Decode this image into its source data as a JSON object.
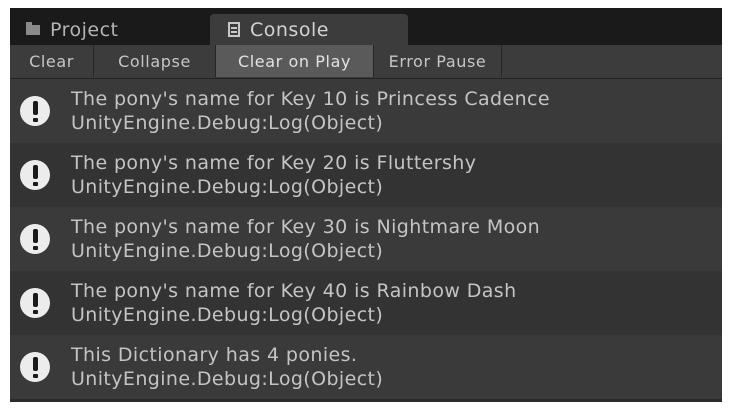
{
  "tabs": [
    {
      "label": "Project",
      "icon": "folder-icon",
      "active": false
    },
    {
      "label": "Console",
      "icon": "console-icon",
      "active": true
    }
  ],
  "toolbar": {
    "clear": "Clear",
    "collapse": "Collapse",
    "clear_on_play": "Clear on Play",
    "error_pause": "Error Pause",
    "clear_on_play_active": true
  },
  "log": [
    {
      "message": "The pony's name for Key 10 is Princess Cadence",
      "source": "UnityEngine.Debug:Log(Object)",
      "icon": "warning-icon"
    },
    {
      "message": "The pony's name for Key 20 is Fluttershy",
      "source": "UnityEngine.Debug:Log(Object)",
      "icon": "warning-icon"
    },
    {
      "message": "The pony's name for Key 30 is Nightmare Moon",
      "source": "UnityEngine.Debug:Log(Object)",
      "icon": "warning-icon"
    },
    {
      "message": "The pony's name for Key 40 is Rainbow Dash",
      "source": "UnityEngine.Debug:Log(Object)",
      "icon": "warning-icon"
    },
    {
      "message": "This Dictionary has 4 ponies.",
      "source": "UnityEngine.Debug:Log(Object)",
      "icon": "warning-icon"
    }
  ],
  "colors": {
    "background": "#2b2b2b",
    "tab_bar": "#1a1a1a",
    "active_tab": "#3c3c3c",
    "row_odd": "#3a3a3a",
    "row_even": "#333333",
    "text": "#c4c4c4",
    "toggled_button": "#5a5a5a"
  }
}
